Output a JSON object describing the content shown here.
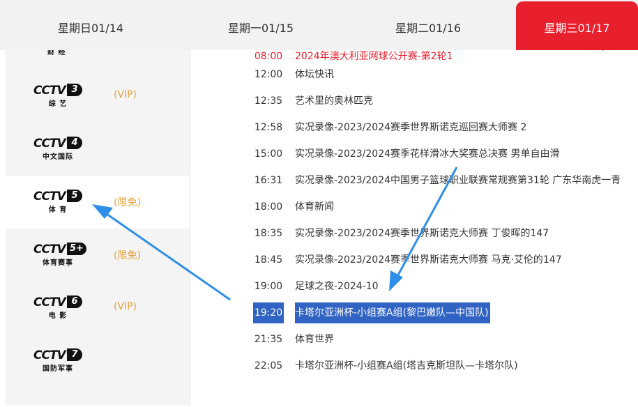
{
  "tabs": [
    {
      "label": "星期日01/14"
    },
    {
      "label": "星期一01/15"
    },
    {
      "label": "星期二01/16"
    },
    {
      "label": "星期三01/17",
      "active": true
    }
  ],
  "channels": {
    "partial_top_sub": "财 经",
    "items": [
      {
        "mark": "CCTV",
        "num": "3",
        "sub": "综 艺",
        "badge": "(VIP)"
      },
      {
        "mark": "CCTV",
        "num": "4",
        "sub": "中文国际",
        "badge": ""
      },
      {
        "mark": "CCTV",
        "num": "5",
        "sub": "体 育",
        "badge": "(限免)",
        "active": true
      },
      {
        "mark": "CCTV",
        "num": "5+",
        "sub": "体育赛事",
        "badge": "(限免)"
      },
      {
        "mark": "CCTV",
        "num": "6",
        "sub": "电 影",
        "badge": "(VIP)"
      },
      {
        "mark": "CCTV",
        "num": "7",
        "sub": "国防军事",
        "badge": ""
      }
    ]
  },
  "programs": [
    {
      "time": "08:00",
      "name": "2024年澳大利亚网球公开赛-第2轮1"
    },
    {
      "time": "12:00",
      "name": "体坛快讯"
    },
    {
      "time": "12:35",
      "name": "艺术里的奥林匹克"
    },
    {
      "time": "12:58",
      "name": "实况录像-2023/2024赛季世界斯诺克巡回赛大师赛 2"
    },
    {
      "time": "15:00",
      "name": "实况录像-2023/2024赛季花样滑冰大奖赛总决赛 男单自由滑"
    },
    {
      "time": "16:31",
      "name": "实况录像-2023/2024中国男子篮球职业联赛常规赛第31轮 广东华南虎一青"
    },
    {
      "time": "18:00",
      "name": "体育新闻"
    },
    {
      "time": "18:35",
      "name": "实况录像-2023/2024赛季世界斯诺克大师赛 丁俊晖的147"
    },
    {
      "time": "18:45",
      "name": "实况录像-2023/2024赛季世界斯诺克大师赛 马克·艾伦的147"
    },
    {
      "time": "19:00",
      "name": "足球之夜-2024-10"
    },
    {
      "time": "19:20",
      "name": "卡塔尔亚洲杯-小组赛A组(黎巴嫩队—中国队)",
      "highlighted": true
    },
    {
      "time": "21:35",
      "name": "体育世界"
    },
    {
      "time": "22:05",
      "name": "卡塔尔亚洲杯-小组赛A组(塔吉克斯坦队—卡塔尔队)"
    }
  ],
  "colors": {
    "accent": "#e8202e",
    "highlight": "#3063c4",
    "badge": "#e6a23c",
    "arrow": "#2f8fe6"
  }
}
